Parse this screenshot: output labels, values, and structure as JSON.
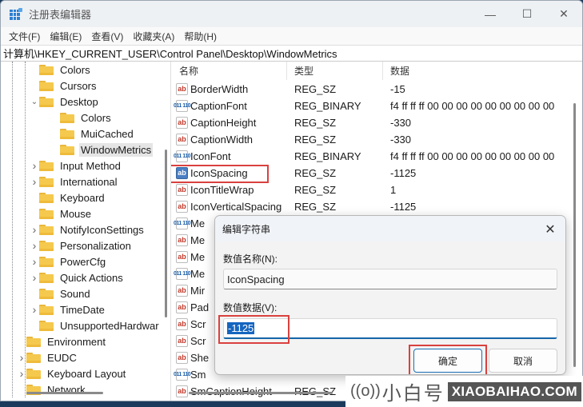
{
  "window": {
    "title": "注册表编辑器",
    "controls": {
      "minimize": "—",
      "maximize": "☐",
      "close": "✕"
    }
  },
  "menu": [
    "文件(F)",
    "编辑(E)",
    "查看(V)",
    "收藏夹(A)",
    "帮助(H)"
  ],
  "address": "计算机\\HKEY_CURRENT_USER\\Control Panel\\Desktop\\WindowMetrics",
  "tree": [
    {
      "label": "Colors",
      "level": 2,
      "expander": "none",
      "selected": false
    },
    {
      "label": "Cursors",
      "level": 2,
      "expander": "none",
      "selected": false
    },
    {
      "label": "Desktop",
      "level": 2,
      "expander": "expanded",
      "selected": false
    },
    {
      "label": "Colors",
      "level": 3,
      "expander": "none",
      "selected": false
    },
    {
      "label": "MuiCached",
      "level": 3,
      "expander": "none",
      "selected": false
    },
    {
      "label": "WindowMetrics",
      "level": 3,
      "expander": "none",
      "selected": true
    },
    {
      "label": "Input Method",
      "level": 2,
      "expander": "collapsed",
      "selected": false
    },
    {
      "label": "International",
      "level": 2,
      "expander": "collapsed",
      "selected": false
    },
    {
      "label": "Keyboard",
      "level": 2,
      "expander": "none",
      "selected": false
    },
    {
      "label": "Mouse",
      "level": 2,
      "expander": "none",
      "selected": false
    },
    {
      "label": "NotifyIconSettings",
      "level": 2,
      "expander": "collapsed",
      "selected": false
    },
    {
      "label": "Personalization",
      "level": 2,
      "expander": "collapsed",
      "selected": false
    },
    {
      "label": "PowerCfg",
      "level": 2,
      "expander": "collapsed",
      "selected": false
    },
    {
      "label": "Quick Actions",
      "level": 2,
      "expander": "collapsed",
      "selected": false
    },
    {
      "label": "Sound",
      "level": 2,
      "expander": "none",
      "selected": false
    },
    {
      "label": "TimeDate",
      "level": 2,
      "expander": "collapsed",
      "selected": false
    },
    {
      "label": "UnsupportedHardwar",
      "level": 2,
      "expander": "none",
      "selected": false
    },
    {
      "label": "Environment",
      "level": 1,
      "expander": "none",
      "selected": false
    },
    {
      "label": "EUDC",
      "level": 1,
      "expander": "collapsed",
      "selected": false
    },
    {
      "label": "Keyboard Layout",
      "level": 1,
      "expander": "collapsed",
      "selected": false
    },
    {
      "label": "Network",
      "level": 1,
      "expander": "none",
      "selected": false
    }
  ],
  "list": {
    "columns": {
      "name": "名称",
      "type": "类型",
      "data": "数据"
    },
    "rows": [
      {
        "name": "BorderWidth",
        "type": "REG_SZ",
        "data": "-15",
        "icon": "sz"
      },
      {
        "name": "CaptionFont",
        "type": "REG_BINARY",
        "data": "f4 ff ff ff 00 00 00 00 00 00 00 00 00",
        "icon": "bin"
      },
      {
        "name": "CaptionHeight",
        "type": "REG_SZ",
        "data": "-330",
        "icon": "sz"
      },
      {
        "name": "CaptionWidth",
        "type": "REG_SZ",
        "data": "-330",
        "icon": "sz"
      },
      {
        "name": "IconFont",
        "type": "REG_BINARY",
        "data": "f4 ff ff ff 00 00 00 00 00 00 00 00 00",
        "icon": "bin"
      },
      {
        "name": "IconSpacing",
        "type": "REG_SZ",
        "data": "-1125",
        "icon": "sz",
        "selected": true
      },
      {
        "name": "IconTitleWrap",
        "type": "REG_SZ",
        "data": "1",
        "icon": "sz"
      },
      {
        "name": "IconVerticalSpacing",
        "type": "REG_SZ",
        "data": "-1125",
        "icon": "sz"
      },
      {
        "name": "Me",
        "type": "",
        "data": "",
        "icon": "bin"
      },
      {
        "name": "Me",
        "type": "",
        "data": "",
        "icon": "sz"
      },
      {
        "name": "Me",
        "type": "",
        "data": "",
        "icon": "sz"
      },
      {
        "name": "Me",
        "type": "",
        "data": "",
        "icon": "bin"
      },
      {
        "name": "Mir",
        "type": "",
        "data": "",
        "icon": "sz"
      },
      {
        "name": "Pad",
        "type": "",
        "data": "",
        "icon": "sz"
      },
      {
        "name": "Scr",
        "type": "",
        "data": "",
        "icon": "sz"
      },
      {
        "name": "Scr",
        "type": "",
        "data": "",
        "icon": "sz"
      },
      {
        "name": "She",
        "type": "",
        "data": "",
        "icon": "sz"
      },
      {
        "name": "Sm",
        "type": "",
        "data": "",
        "icon": "bin"
      },
      {
        "name": "SmCaptionHeight",
        "type": "REG_SZ",
        "data": "",
        "icon": "sz"
      }
    ]
  },
  "dialog": {
    "title": "编辑字符串",
    "close": "✕",
    "name_label": "数值名称(N):",
    "name_value": "IconSpacing",
    "data_label": "数值数据(V):",
    "data_value": "-1125",
    "ok": "确定",
    "cancel": "取消"
  },
  "watermark": {
    "icon": "((o))",
    "cn": "小白号",
    "url": "XIAOBAIHAO.COM"
  },
  "colors": {
    "accent": "#1565c0",
    "highlight_box": "#d9413e",
    "folder": "#f5c94e"
  }
}
